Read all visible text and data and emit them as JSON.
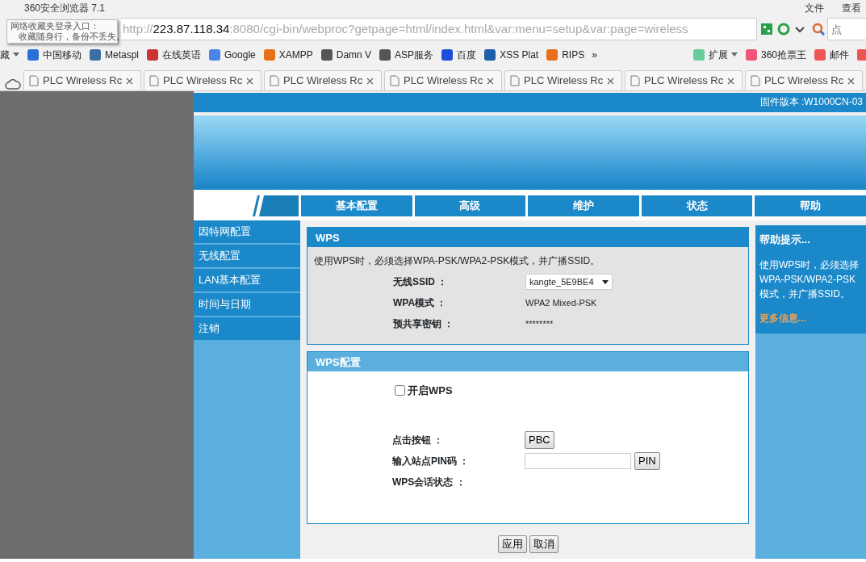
{
  "browser": {
    "title": "360安全浏览器 7.1",
    "menu": [
      "文件",
      "查看"
    ],
    "address": {
      "host": "223.87.118.34",
      "prefix": "http://",
      "rest": ":8080/cgi-bin/webproc?getpage=html/index.html&var:menu=setup&var:page=wireless"
    },
    "search": {
      "placeholder": "点"
    },
    "tooltip": {
      "title": "网络收藏夹登录入口：",
      "text": "收藏随身行，备份不丢失。"
    },
    "bookmarks": [
      {
        "label": "藏",
        "kind": "menu"
      },
      {
        "label": "中国移动",
        "kind": "link"
      },
      {
        "label": "Metaspl",
        "kind": "link"
      },
      {
        "label": "在线英语",
        "kind": "link"
      },
      {
        "label": "Google",
        "kind": "link"
      },
      {
        "label": "XAMPP",
        "kind": "link"
      },
      {
        "label": "Damn V",
        "kind": "link"
      },
      {
        "label": "ASP服务",
        "kind": "link"
      },
      {
        "label": "百度",
        "kind": "link"
      },
      {
        "label": "XSS Plat",
        "kind": "link"
      },
      {
        "label": "RIPS",
        "kind": "link"
      },
      {
        "label": "»",
        "kind": "more"
      }
    ],
    "extras": [
      {
        "label": "扩展",
        "kind": "menu"
      },
      {
        "label": "360抢票王",
        "kind": "link"
      },
      {
        "label": "邮件",
        "kind": "link"
      }
    ],
    "tabs": [
      {
        "label": "PLC Wireless Rc"
      },
      {
        "label": "PLC Wireless Rc"
      },
      {
        "label": "PLC Wireless Rc"
      },
      {
        "label": "PLC Wireless Rc"
      },
      {
        "label": "PLC Wireless Rc"
      },
      {
        "label": "PLC Wireless Rc"
      },
      {
        "label": "PLC Wireless Rc"
      }
    ]
  },
  "page": {
    "firmware": "固件版本 :W1000CN-03",
    "nav": [
      "基本配置",
      "高级",
      "维护",
      "状态",
      "帮助"
    ],
    "sidebar": [
      {
        "label": "因特网配置"
      },
      {
        "label": "无线配置"
      },
      {
        "label": "LAN基本配置"
      },
      {
        "label": "时间与日期"
      },
      {
        "label": "注销"
      }
    ],
    "wps": {
      "title": "WPS",
      "note": "使用WPS时，必须选择WPA-PSK/WPA2-PSK模式，并广播SSID。",
      "rows": [
        {
          "label": "无线SSID ：",
          "kind": "select",
          "value": "kangte_5E9BE4"
        },
        {
          "label": "WPA模式 ：",
          "kind": "text",
          "value": "WPA2 Mixed-PSK"
        },
        {
          "label": "预共享密钥 ：",
          "kind": "text",
          "value": "********"
        }
      ]
    },
    "wps_config": {
      "title": "WPS配置",
      "enable": {
        "label": "开启WPS",
        "checked": false
      },
      "rows": [
        {
          "label": "点击按钮 ：",
          "kind": "button",
          "button": "PBC"
        },
        {
          "label": "输入站点PIN码 ：",
          "kind": "input",
          "button": "PIN"
        },
        {
          "label": "WPS会话状态 ：",
          "kind": "text"
        }
      ]
    },
    "buttons": [
      "应用",
      "取消"
    ],
    "help": {
      "title": "帮助提示...",
      "text": "使用WPS时，必须选择WPA-PSK/WPA2-PSK模式，并广播SSID。",
      "link": "更多信息..."
    }
  }
}
